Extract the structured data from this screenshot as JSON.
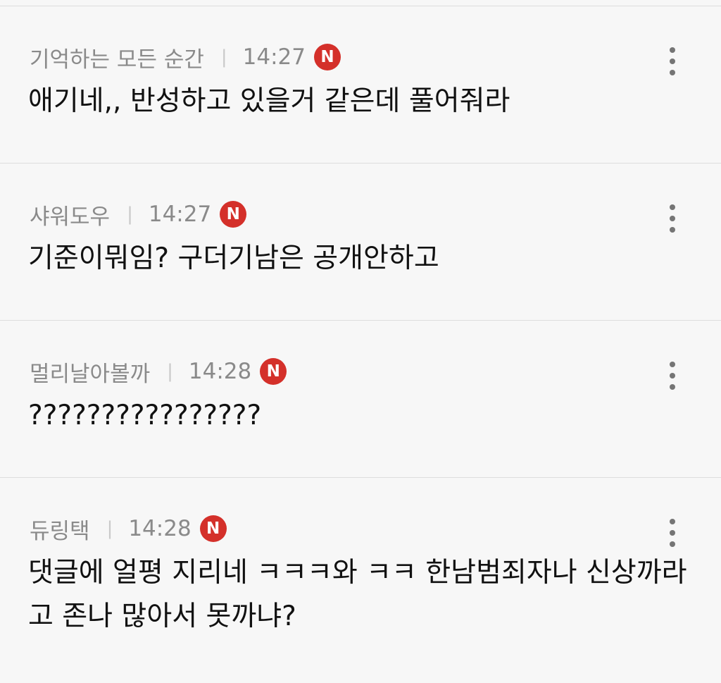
{
  "comments": [
    {
      "author": "기억하는 모든 순간",
      "separator": "|",
      "time": "14:27",
      "badge": "N",
      "text": "애기네,, 반성하고 있을거 같은데 풀어줘라"
    },
    {
      "author": "샤워도우",
      "separator": "|",
      "time": "14:27",
      "badge": "N",
      "text": "기준이뭐임? 구더기남은 공개안하고"
    },
    {
      "author": "멀리날아볼까",
      "separator": "|",
      "time": "14:28",
      "badge": "N",
      "text": "????????????????"
    },
    {
      "author": "듀링택",
      "separator": "|",
      "time": "14:28",
      "badge": "N",
      "text": "댓글에 얼평 지리네 ㅋㅋㅋ와 ㅋㅋ 한남범죄자나 신상까라고 존나 많아서 못까냐?"
    }
  ],
  "colors": {
    "badge": "#d4302a",
    "background": "#f7f7f7",
    "meta_text": "#8a8a8a",
    "body_text": "#111111"
  },
  "icons": {
    "more": "more-vertical-icon",
    "new": "new-badge-icon"
  }
}
